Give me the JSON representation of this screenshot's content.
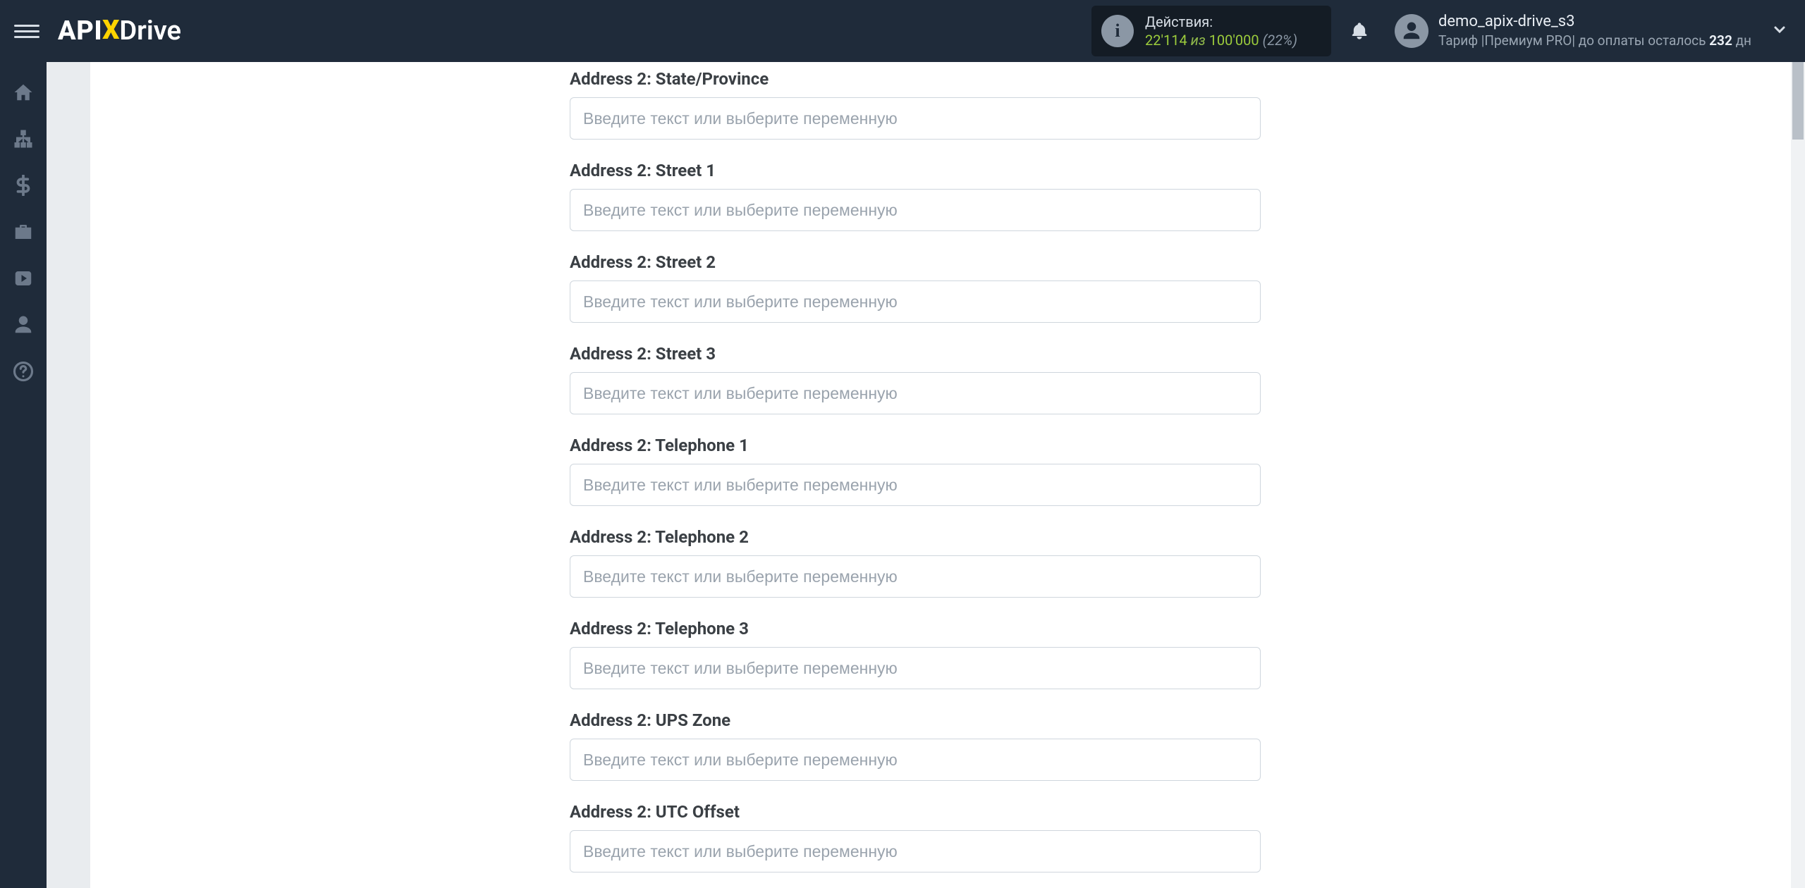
{
  "header": {
    "logo": {
      "api": "API",
      "drive": "Drive"
    },
    "actions_label": "Действия:",
    "actions_used": "22'114",
    "actions_of_word": "из",
    "actions_total": "100'000",
    "actions_percent": "(22%)",
    "user_name": "demo_apix-drive_s3",
    "tariff_prefix": "Тариф |",
    "tariff_name": "Премиум PRO",
    "payment_prefix": "| до оплаты осталось ",
    "payment_days": "232",
    "payment_suffix": " дн"
  },
  "sidebar": {
    "items": [
      {
        "name": "home-icon"
      },
      {
        "name": "sitemap-icon"
      },
      {
        "name": "dollar-icon"
      },
      {
        "name": "briefcase-icon"
      },
      {
        "name": "youtube-icon"
      },
      {
        "name": "user-icon"
      },
      {
        "name": "help-icon"
      }
    ]
  },
  "form": {
    "placeholder": "Введите текст или выберите переменную",
    "fields": [
      {
        "label": "Address 2: State/Province"
      },
      {
        "label": "Address 2: Street 1"
      },
      {
        "label": "Address 2: Street 2"
      },
      {
        "label": "Address 2: Street 3"
      },
      {
        "label": "Address 2: Telephone 1"
      },
      {
        "label": "Address 2: Telephone 2"
      },
      {
        "label": "Address 2: Telephone 3"
      },
      {
        "label": "Address 2: UPS Zone"
      },
      {
        "label": "Address 2: UTC Offset"
      }
    ]
  }
}
